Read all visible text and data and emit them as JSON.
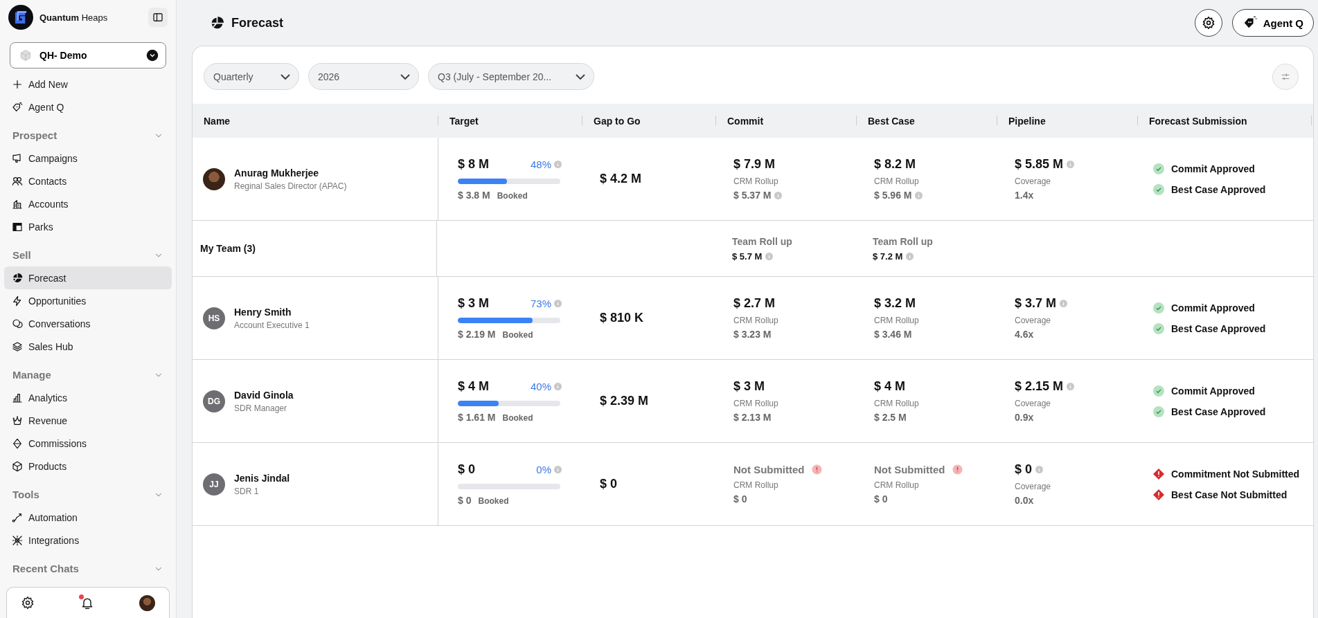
{
  "sidebar": {
    "brand": "**Quantum** Heaps",
    "workspace": "QH- Demo",
    "actions": [
      {
        "label": "Add New"
      },
      {
        "label": "Agent Q"
      }
    ],
    "sections": [
      {
        "title": "Prospect",
        "items": [
          {
            "label": "Campaigns",
            "selected": false
          },
          {
            "label": "Contacts",
            "selected": false
          },
          {
            "label": "Accounts",
            "selected": false
          },
          {
            "label": "Parks",
            "selected": false
          }
        ]
      },
      {
        "title": "Sell",
        "items": [
          {
            "label": "Forecast",
            "selected": true
          },
          {
            "label": "Opportunities",
            "selected": false
          },
          {
            "label": "Conversations",
            "selected": false
          },
          {
            "label": "Sales Hub",
            "selected": false
          }
        ]
      },
      {
        "title": "Manage",
        "items": [
          {
            "label": "Analytics",
            "selected": false
          },
          {
            "label": "Revenue",
            "selected": false
          },
          {
            "label": "Commissions",
            "selected": false
          },
          {
            "label": "Products",
            "selected": false
          }
        ]
      },
      {
        "title": "Tools",
        "items": [
          {
            "label": "Automation",
            "selected": false
          },
          {
            "label": "Integrations",
            "selected": false
          }
        ]
      },
      {
        "title": "Recent Chats"
      }
    ],
    "footer": {
      "notification": true
    }
  },
  "header": {
    "title": "Forecast",
    "agent_button": "Agent Q"
  },
  "filters": [
    {
      "value": "Quarterly"
    },
    {
      "value": "2026"
    },
    {
      "value": "Q3 (July - September 20..."
    }
  ],
  "table": {
    "columns": [
      "Name",
      "Target",
      "Gap to Go",
      "Commit",
      "Best Case",
      "Pipeline",
      "Forecast Submission"
    ],
    "rows": [
      {
        "kind": "member",
        "avatar": {
          "kind": "photo"
        },
        "name": "Anurag Mukherjee",
        "role": "Reginal Sales Director (APAC)",
        "target": {
          "amount": "$ 8 M",
          "percent": "48%",
          "level": 0.48,
          "booked": "$ 3.8 M",
          "booked_label": "Booked"
        },
        "gap": "$ 4.2 M",
        "commit": {
          "kind": "value",
          "amount": "$ 7.9 M",
          "sub_label": "CRM Rollup",
          "sub_value": "$ 5.37 M",
          "info": true
        },
        "best_case": {
          "kind": "value",
          "amount": "$ 8.2 M",
          "sub_label": "CRM Rollup",
          "sub_value": "$ 5.96 M",
          "info": true
        },
        "pipeline": {
          "amount": "$ 5.85 M",
          "label": "Coverage",
          "coverage": "1.4x"
        },
        "submissions": [
          {
            "kind": "approved",
            "label": "Commit Approved"
          },
          {
            "kind": "approved",
            "label": "Best Case Approved"
          }
        ]
      },
      {
        "kind": "team",
        "label": "My Team (3)",
        "commit": {
          "label": "Team Roll up",
          "value": "$ 5.7 M"
        },
        "best_case": {
          "label": "Team Roll up",
          "value": "$ 7.2 M"
        }
      },
      {
        "kind": "member",
        "avatar": {
          "kind": "initials",
          "initials": "HS"
        },
        "name": "Henry Smith",
        "role": "Account Executive 1",
        "target": {
          "amount": "$ 3 M",
          "percent": "73%",
          "level": 0.73,
          "booked": "$ 2.19 M",
          "booked_label": "Booked"
        },
        "gap": "$ 810 K",
        "commit": {
          "kind": "value",
          "amount": "$ 2.7 M",
          "sub_label": "CRM Rollup",
          "sub_value": "$ 3.23 M",
          "info": false
        },
        "best_case": {
          "kind": "value",
          "amount": "$ 3.2 M",
          "sub_label": "CRM Rollup",
          "sub_value": "$ 3.46 M",
          "info": false
        },
        "pipeline": {
          "amount": "$ 3.7 M",
          "label": "Coverage",
          "coverage": "4.6x"
        },
        "submissions": [
          {
            "kind": "approved",
            "label": "Commit Approved"
          },
          {
            "kind": "approved",
            "label": "Best Case Approved"
          }
        ]
      },
      {
        "kind": "member",
        "avatar": {
          "kind": "initials",
          "initials": "DG"
        },
        "name": "David Ginola",
        "role": "SDR Manager",
        "target": {
          "amount": "$ 4 M",
          "percent": "40%",
          "level": 0.4,
          "booked": "$ 1.61 M",
          "booked_label": "Booked"
        },
        "gap": "$ 2.39 M",
        "commit": {
          "kind": "value",
          "amount": "$ 3 M",
          "sub_label": "CRM Rollup",
          "sub_value": "$ 2.13 M",
          "info": false
        },
        "best_case": {
          "kind": "value",
          "amount": "$ 4 M",
          "sub_label": "CRM Rollup",
          "sub_value": "$ 2.5 M",
          "info": false
        },
        "pipeline": {
          "amount": "$ 2.15 M",
          "label": "Coverage",
          "coverage": "0.9x"
        },
        "submissions": [
          {
            "kind": "approved",
            "label": "Commit Approved"
          },
          {
            "kind": "approved",
            "label": "Best Case Approved"
          }
        ]
      },
      {
        "kind": "member",
        "avatar": {
          "kind": "initials",
          "initials": "JJ"
        },
        "name": "Jenis Jindal",
        "role": "SDR 1",
        "target": {
          "amount": "$ 0",
          "percent": "0%",
          "level": 0,
          "booked": "$ 0",
          "booked_label": "Booked"
        },
        "gap": "$ 0",
        "commit": {
          "kind": "not_submitted",
          "status": "Not Submitted",
          "sub_label": "CRM Rollup",
          "sub_value": "$ 0",
          "info": false
        },
        "best_case": {
          "kind": "not_submitted",
          "status": "Not Submitted",
          "sub_label": "CRM Rollup",
          "sub_value": "$ 0",
          "info": false
        },
        "pipeline": {
          "amount": "$ 0",
          "label": "Coverage",
          "coverage": "0.0x"
        },
        "submissions": [
          {
            "kind": "not_submitted",
            "label": "Commitment Not Submitted"
          },
          {
            "kind": "not_submitted",
            "label": "Best Case Not Submitted"
          }
        ]
      }
    ]
  }
}
